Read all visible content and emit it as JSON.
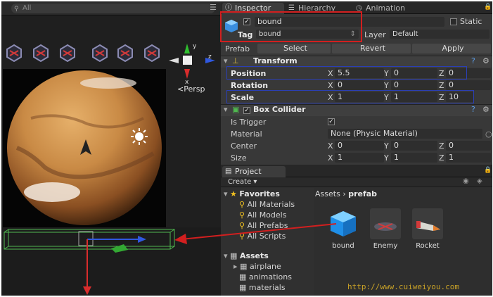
{
  "scene": {
    "search_placeholder": "All",
    "persp_label": "Persp",
    "gizmo_axes": {
      "x": "x",
      "y": "y",
      "z": "z"
    }
  },
  "tabs": {
    "inspector": "Inspector",
    "hierarchy": "Hierarchy",
    "animation": "Animation"
  },
  "object": {
    "name": "bound",
    "active_checked": true,
    "static_label": "Static",
    "tag_label": "Tag",
    "tag_value": "bound",
    "layer_label": "Layer",
    "layer_value": "Default",
    "prefab_label": "Prefab",
    "prefab_select": "Select",
    "prefab_revert": "Revert",
    "prefab_apply": "Apply"
  },
  "transform": {
    "title": "Transform",
    "position_label": "Position",
    "rotation_label": "Rotation",
    "scale_label": "Scale",
    "position": {
      "x": "5.5",
      "y": "0",
      "z": "0"
    },
    "rotation": {
      "x": "0",
      "y": "0",
      "z": "0"
    },
    "scale": {
      "x": "1",
      "y": "1",
      "z": "10"
    }
  },
  "collider": {
    "title": "Box Collider",
    "is_trigger_label": "Is Trigger",
    "is_trigger_checked": true,
    "material_label": "Material",
    "material_value": "None (Physic Material)",
    "center_label": "Center",
    "size_label": "Size",
    "center": {
      "x": "0",
      "y": "0",
      "z": "0"
    },
    "size": {
      "x": "1",
      "y": "1",
      "z": "1"
    }
  },
  "axis_letters": {
    "x": "X",
    "y": "Y",
    "z": "Z"
  },
  "project": {
    "tab": "Project",
    "create_label": "Create",
    "breadcrumb_root": "Assets",
    "breadcrumb_sep": "›",
    "breadcrumb_current": "prefab",
    "favorites_label": "Favorites",
    "favorites": [
      "All Materials",
      "All Models",
      "All Prefabs",
      "All Scripts"
    ],
    "assets_label": "Assets",
    "folders": [
      "airplane",
      "animations",
      "materials"
    ],
    "assets": [
      "bound",
      "Enemy",
      "Rocket"
    ]
  },
  "watermark": "http://www.cuiweiyou.com",
  "colors": {
    "highlight_red": "#d21f1f",
    "highlight_blue": "#2b3fb5",
    "panel_bg": "#383838"
  }
}
